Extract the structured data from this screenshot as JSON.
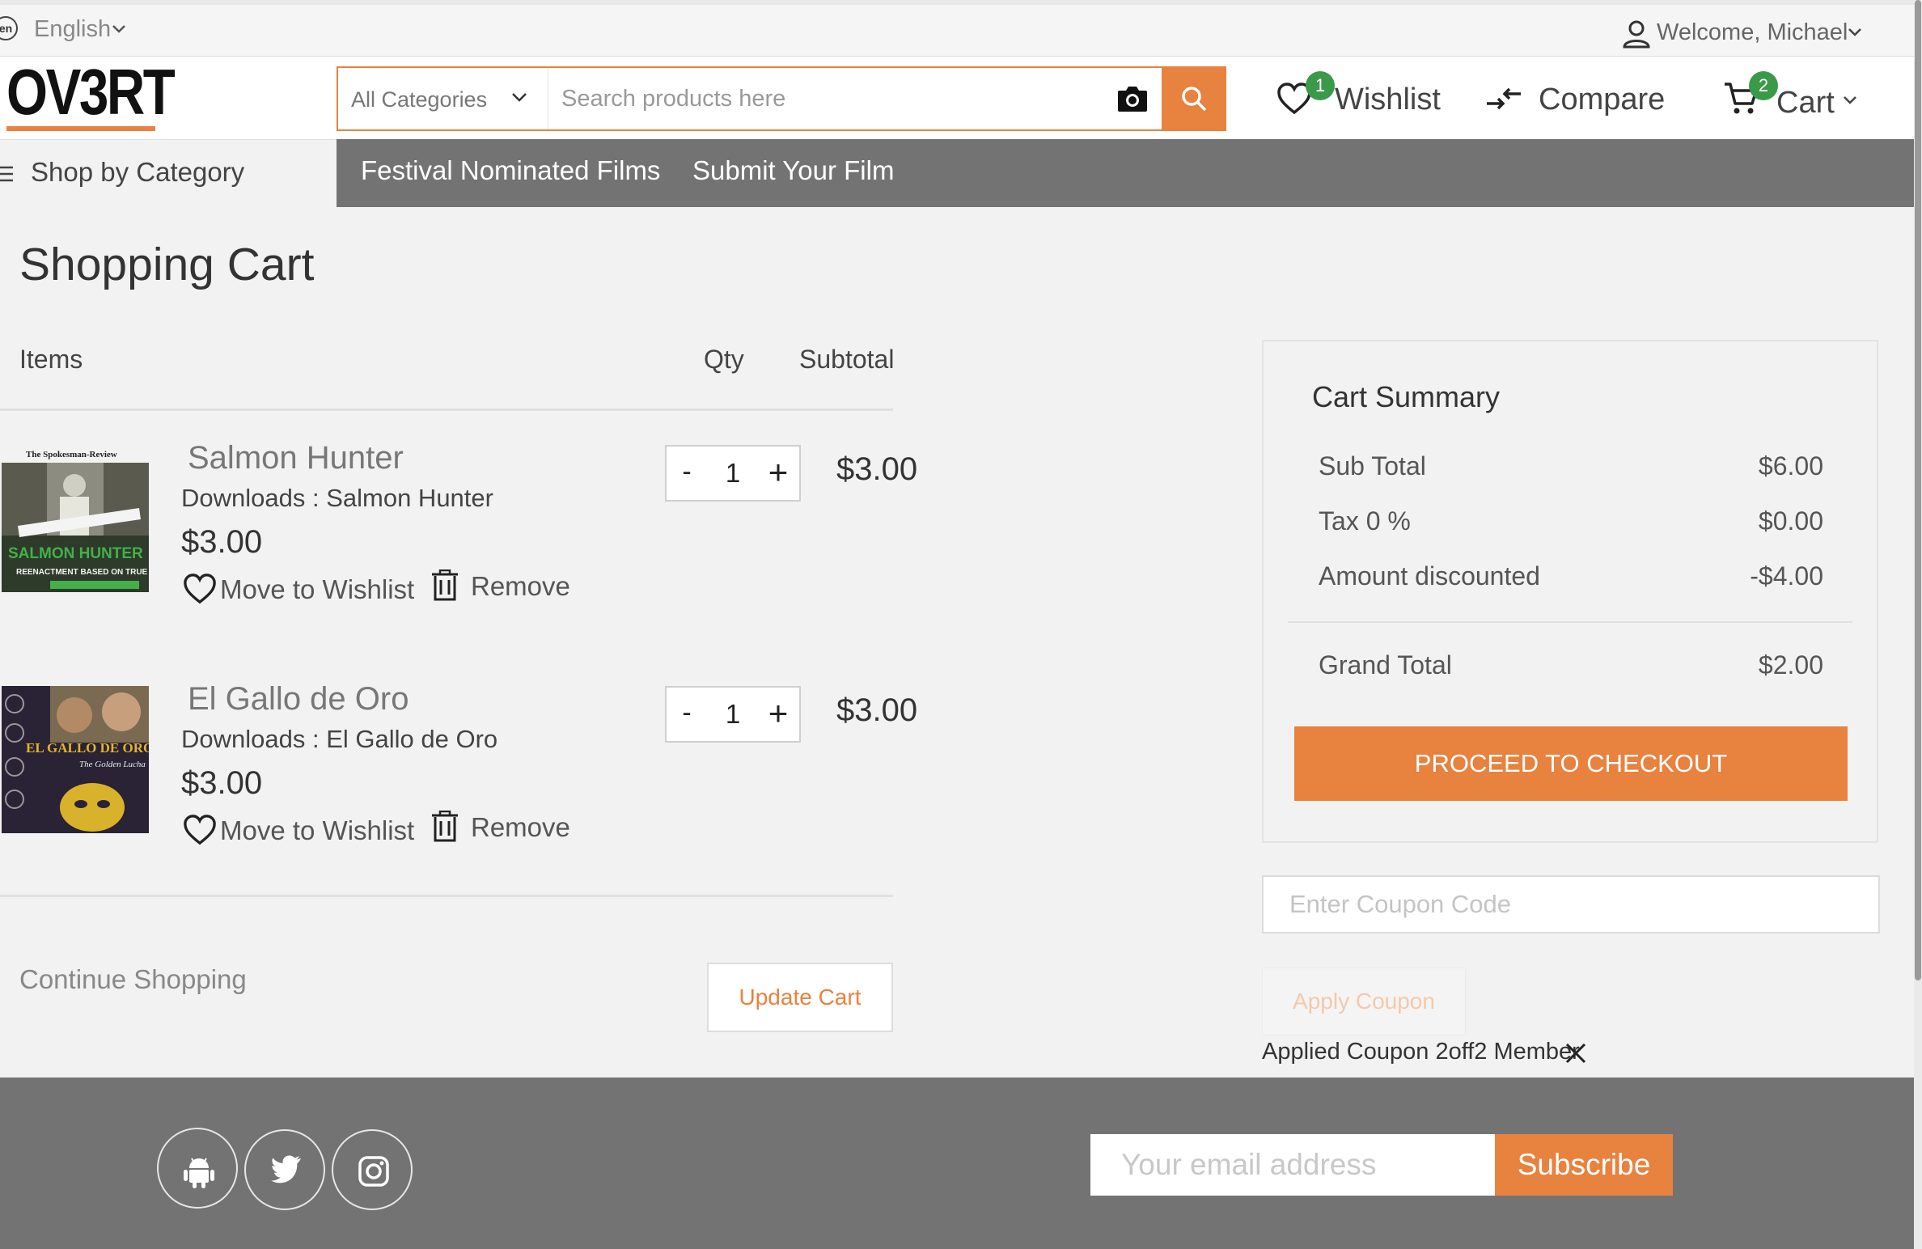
{
  "topbar": {
    "lang_code": "en",
    "language": "English",
    "welcome": "Welcome, Michael"
  },
  "header": {
    "logo": "OV3RT",
    "category_select": "All Categories",
    "search_placeholder": "Search products here",
    "wishlist_label": "Wishlist",
    "wishlist_count": "1",
    "compare_label": "Compare",
    "cart_label": "Cart",
    "cart_count": "2"
  },
  "nav": {
    "shop_by_category": "Shop by Category",
    "links": [
      "Festival Nominated Films",
      "Submit Your Film"
    ]
  },
  "cart": {
    "title": "Shopping Cart",
    "columns": {
      "items": "Items",
      "qty": "Qty",
      "subtotal": "Subtotal"
    },
    "items": [
      {
        "name": "Salmon Hunter",
        "downloads": "Downloads : Salmon Hunter",
        "price": "$3.00",
        "qty": "1",
        "subtotal": "$3.00",
        "poster_texts": [
          "The Spokesman-Review",
          "SALMON HUNTER",
          "REENACTMENT BASED ON TRUE STORY"
        ]
      },
      {
        "name": "El Gallo de Oro",
        "downloads": "Downloads : El Gallo de Oro",
        "price": "$3.00",
        "qty": "1",
        "subtotal": "$3.00",
        "poster_texts": [
          "EL GALLO DE ORO",
          "The Golden Lucha"
        ]
      }
    ],
    "move_to_wishlist": "Move to Wishlist",
    "remove": "Remove",
    "qty_minus": "-",
    "qty_plus": "+",
    "continue_shopping": "Continue Shopping",
    "update_cart": "Update Cart"
  },
  "summary": {
    "title": "Cart Summary",
    "rows": [
      {
        "label": "Sub Total",
        "value": "$6.00"
      },
      {
        "label": "Tax 0 %",
        "value": "$0.00"
      },
      {
        "label": "Amount discounted",
        "value": "-$4.00"
      }
    ],
    "grand_total_label": "Grand Total",
    "grand_total_value": "$2.00",
    "checkout": "PROCEED TO CHECKOUT"
  },
  "coupon": {
    "placeholder": "Enter Coupon Code",
    "apply": "Apply Coupon",
    "applied": "Applied Coupon 2off2 Member"
  },
  "footer": {
    "email_placeholder": "Your email address",
    "subscribe": "Subscribe",
    "social_icons": [
      "android-icon",
      "twitter-icon",
      "instagram-icon"
    ]
  },
  "colors": {
    "accent": "#e8823f",
    "nav_bar": "#737373",
    "badge": "#3a9a4a"
  }
}
